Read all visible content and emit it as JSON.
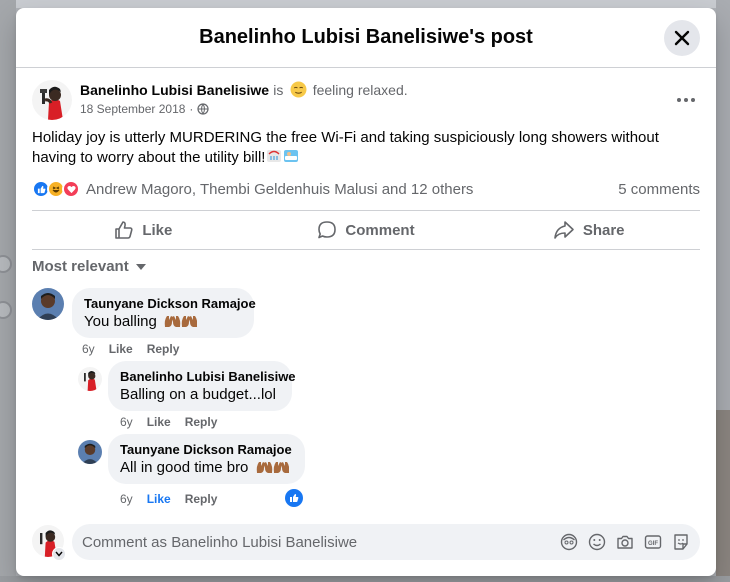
{
  "modal": {
    "title": "Banelinho Lubisi Banelisiwe's post"
  },
  "post": {
    "author": "Banelinho Lubisi Banelisiwe",
    "feeling_is": "is",
    "feeling": "feeling relaxed.",
    "feeling_icon": "relieved-face-icon",
    "date": "18 September 2018",
    "date_sep": "·",
    "audience_icon": "globe-icon",
    "text": "Holiday joy is utterly MURDERING the free Wi-Fi and taking suspiciously long showers without having to worry about the utility bill!",
    "text_emojis": [
      "shower-icon",
      "bathtub-icon"
    ]
  },
  "reactions": {
    "icons": [
      "like-reaction-icon",
      "haha-reaction-icon",
      "love-reaction-icon"
    ],
    "names": "Andrew Magoro, Thembi Geldenhuis Malusi and 12 others",
    "comments_count": "5 comments"
  },
  "actions": {
    "like": "Like",
    "comment": "Comment",
    "share": "Share"
  },
  "sort": {
    "label": "Most relevant"
  },
  "comments": [
    {
      "author": "Taunyane Dickson Ramajoe",
      "text": "You balling",
      "emoji": "raising-hands-icon",
      "time": "6y",
      "like": "Like",
      "reply": "Reply",
      "liked": false
    },
    {
      "author": "Banelinho Lubisi Banelisiwe",
      "text": "Balling on a budget...lol",
      "time": "6y",
      "like": "Like",
      "reply": "Reply",
      "liked": false
    },
    {
      "author": "Taunyane Dickson Ramajoe",
      "text": "All in good time bro",
      "emoji": "raising-hands-icon",
      "time": "6y",
      "like": "Like",
      "reply": "Reply",
      "liked": true,
      "reaction": "like-reaction-icon"
    }
  ],
  "composer": {
    "placeholder": "Comment as Banelinho Lubisi Banelisiwe",
    "tools": [
      "avatar-sticker-icon",
      "emoji-icon",
      "camera-icon",
      "gif-icon",
      "sticker-icon"
    ]
  },
  "colors": {
    "accent": "#1877f2",
    "secondary_text": "#65676b",
    "bubble": "#f0f2f5",
    "love": "#f33e58",
    "haha": "#f7b125"
  }
}
